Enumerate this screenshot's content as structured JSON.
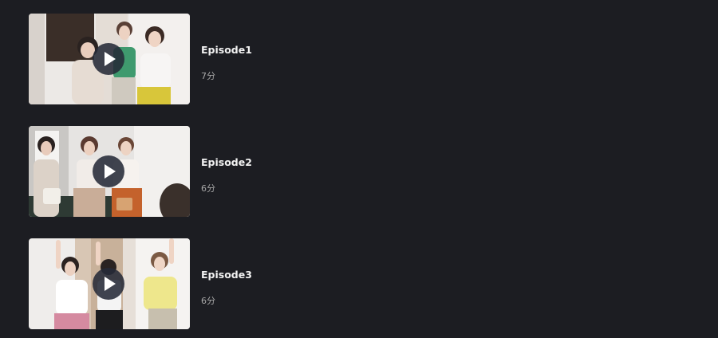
{
  "episodes": [
    {
      "title": "Episode1",
      "duration": "7分"
    },
    {
      "title": "Episode2",
      "duration": "6分"
    },
    {
      "title": "Episode3",
      "duration": "6分"
    }
  ],
  "colors": {
    "background": "#1c1d22",
    "title": "#f2f2f2",
    "duration": "#a8a8a8"
  },
  "icons": {
    "play": "play-icon"
  }
}
